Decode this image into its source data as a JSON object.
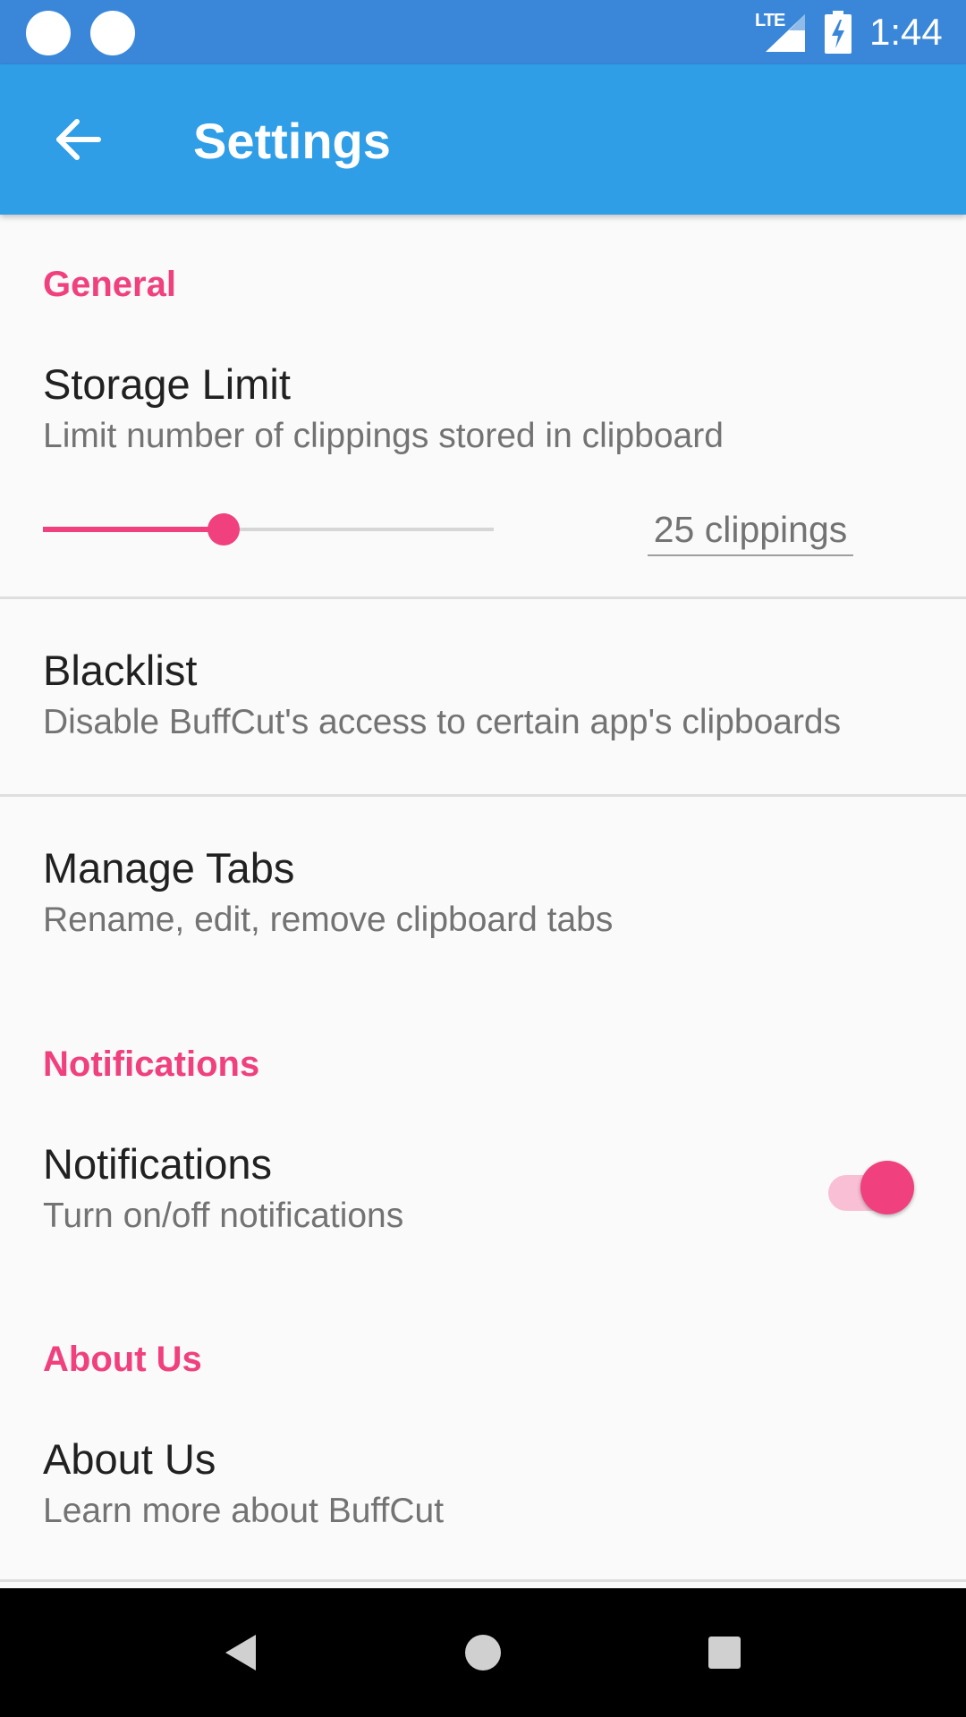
{
  "status_bar": {
    "network": "LTE",
    "time": "1:44"
  },
  "app_bar": {
    "title": "Settings",
    "back_icon": "arrow-back-icon"
  },
  "sections": {
    "general": {
      "header": "General",
      "storage_limit": {
        "title": "Storage Limit",
        "summary": "Limit number of clippings stored in clipboard",
        "slider_fraction": 0.4,
        "value_label": "25 clippings"
      },
      "blacklist": {
        "title": "Blacklist",
        "summary": "Disable BuffCut's access to certain app's clipboards"
      },
      "manage_tabs": {
        "title": "Manage Tabs",
        "summary": "Rename, edit, remove clipboard tabs"
      }
    },
    "notifications": {
      "header": "Notifications",
      "item": {
        "title": "Notifications",
        "summary": "Turn on/off notifications",
        "enabled": true
      }
    },
    "about": {
      "header": "About Us",
      "item": {
        "title": "About Us",
        "summary": "Learn more about BuffCut"
      }
    }
  },
  "nav_bar": {
    "back_icon": "nav-back-icon",
    "home_icon": "nav-home-icon",
    "recents_icon": "nav-recents-icon"
  },
  "colors": {
    "status_bar": "#3a87d9",
    "app_bar": "#2f9ee6",
    "accent": "#f0407e",
    "accent_light": "#f9bfd4",
    "background": "#fafafa",
    "divider": "#dedede",
    "primary_text": "#212121",
    "secondary_text": "#737373"
  }
}
